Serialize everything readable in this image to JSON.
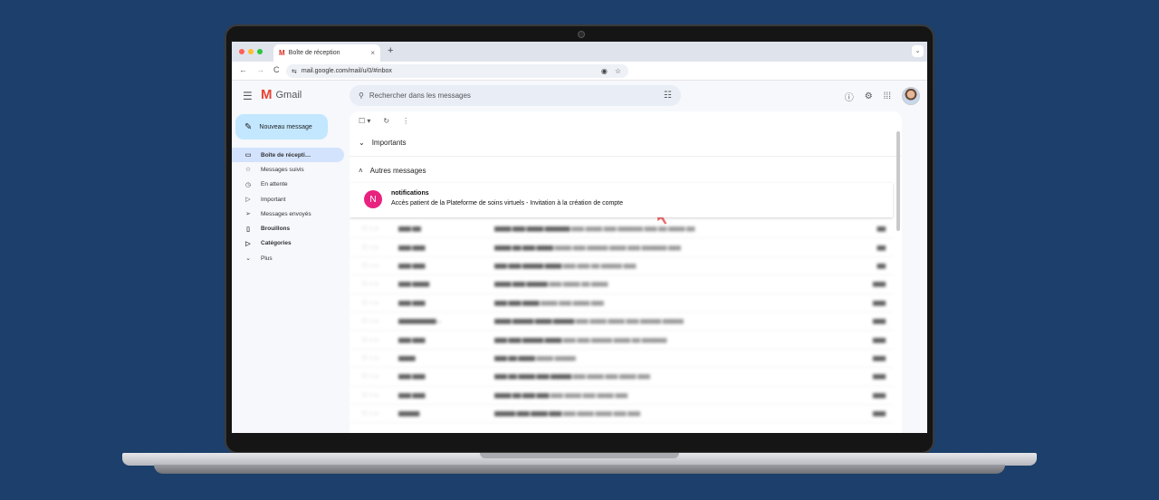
{
  "browser": {
    "tab_title": "Boîte de réception",
    "tab_logo": "M",
    "tab_close": "×",
    "new_tab": "+",
    "tab_menu": "⌄",
    "url": "mail.google.com/mail/u/0/#inbox",
    "nav": {
      "back": "←",
      "forward": "→",
      "reload": "C"
    },
    "omni_icons": {
      "eye": "◉",
      "star": "☆",
      "site": "⇆"
    }
  },
  "gmail": {
    "logo_letter": "M",
    "logo_text": "Gmail",
    "search_placeholder": "Rechercher dans les messages",
    "compose_label": "Nouveau message",
    "nav": [
      {
        "label": "Boîte de récepti…",
        "icon": "▭"
      },
      {
        "label": "Messages suivis",
        "icon": "☆"
      },
      {
        "label": "En attente",
        "icon": "◷"
      },
      {
        "label": "Important",
        "icon": "▷"
      },
      {
        "label": "Messages envoyés",
        "icon": "➢"
      },
      {
        "label": "Brouillons",
        "icon": "▯"
      },
      {
        "label": "Catégories",
        "icon": "▷"
      },
      {
        "label": "Plus",
        "icon": "⌄"
      }
    ],
    "sections": {
      "important": "Importants",
      "others": "Autres messages"
    },
    "highlighted_email": {
      "avatar_letter": "N",
      "sender": "notifications",
      "subject": "Accès patient de la Plateforme de soins virtuels - Invitation à la création de compte"
    }
  },
  "colors": {
    "background": "#1c3f6b",
    "avatar": "#e8227e",
    "compose": "#c2e7ff",
    "active_nav": "#d3e3fd",
    "cursor": "#f06b6b"
  }
}
